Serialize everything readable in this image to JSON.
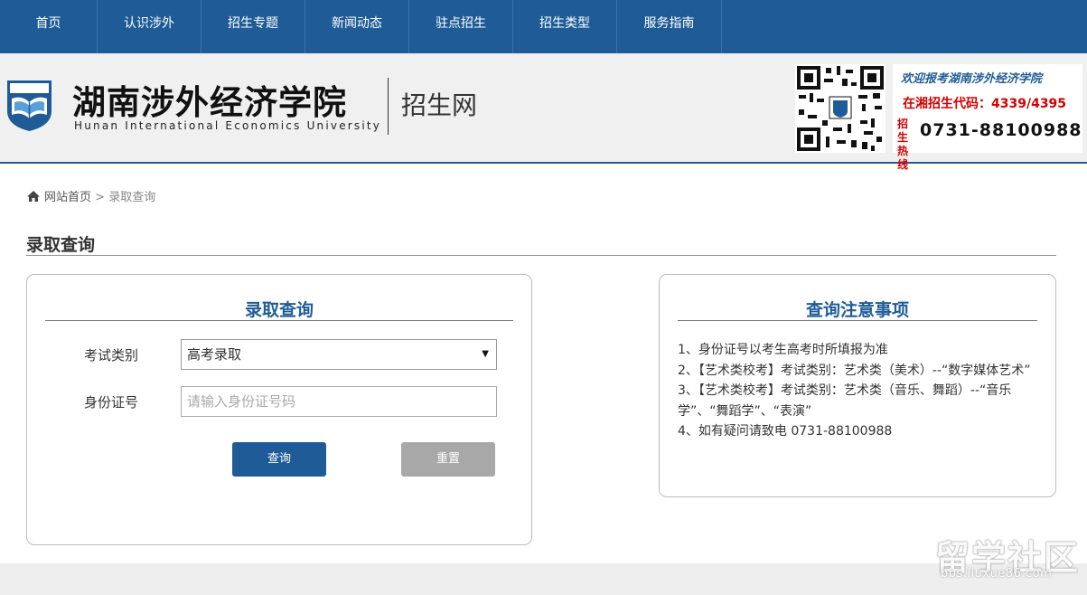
{
  "nav": {
    "items": [
      "首页",
      "认识涉外",
      "招生专题",
      "新闻动态",
      "驻点招生",
      "招生类型",
      "服务指南"
    ]
  },
  "header": {
    "logo_cn": "湖南涉外经济学院",
    "logo_en": "Hunan International Economics University",
    "logo_sub": "招生网",
    "promo_welcome": "欢迎报考湖南涉外经济学院",
    "promo_code": "在湘招生代码：4339/4395",
    "promo_hotline_label": "招生热线",
    "promo_phone": "0731-88100988"
  },
  "breadcrumb": {
    "home": "网站首页",
    "separator": ">",
    "current": "录取查询"
  },
  "page_title": "录取查询",
  "query_form": {
    "title": "录取查询",
    "exam_type_label": "考试类别",
    "exam_type_value": "高考录取",
    "id_label": "身份证号",
    "id_placeholder": "请输入身份证号码",
    "query_button": "查询",
    "reset_button": "重置"
  },
  "notice": {
    "title": "查询注意事项",
    "lines": [
      "1、身份证号以考生高考时所填报为准",
      "2、【艺术类校考】考试类别：艺术类（美术）--“数字媒体艺术”",
      "3、【艺术类校考】考试类别：艺术类（音乐、舞蹈）--“音乐学”、“舞蹈学”、“表演”",
      "4、如有疑问请致电 0731-88100988"
    ]
  },
  "watermark": {
    "main": "留学社区",
    "url": "bbs.liuxue86.com"
  },
  "colors": {
    "brand_blue": "#1f5c97",
    "reset_gray": "#a8a8a8",
    "promo_red": "#d40000"
  }
}
